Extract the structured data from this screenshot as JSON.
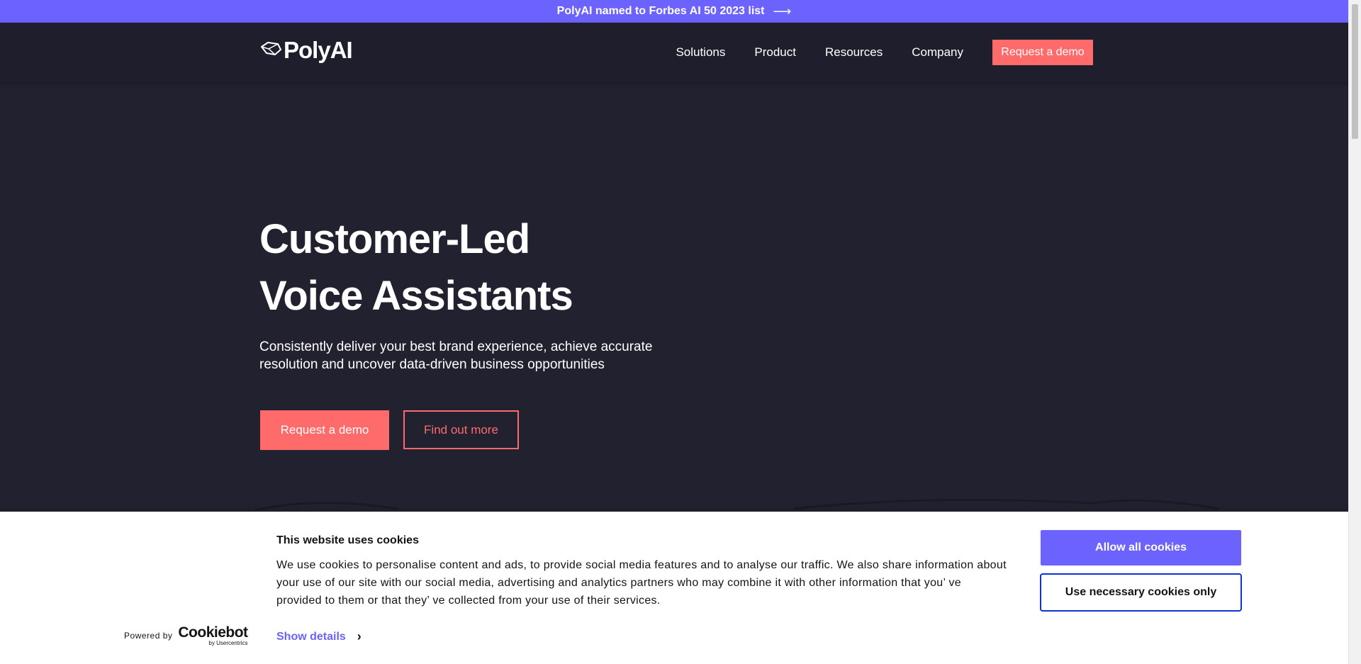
{
  "announcement": {
    "text": "PolyAI named to Forbes AI 50 2023 list",
    "arrow": "⟶"
  },
  "header": {
    "logo_text": "PolyAI",
    "nav": [
      "Solutions",
      "Product",
      "Resources",
      "Company"
    ],
    "cta": "Request a demo"
  },
  "hero": {
    "title_line1": "Customer-Led",
    "title_line2": "Voice Assistants",
    "subtitle": "Consistently deliver your best brand experience, achieve accurate resolution and uncover data-driven business opportunities",
    "primary_cta": "Request a demo",
    "secondary_cta": "Find out more"
  },
  "cookie_banner": {
    "title": "This website uses cookies",
    "text": "We use cookies to personalise content and ads, to provide social media features and to analyse our traffic. We also share information about your use of our site with our social media, advertising and analytics partners who may combine it with other information that you’ ve provided to them or that they’ ve collected from your use of their services.",
    "powered_by": "Powered by",
    "brand": "Cookiebot",
    "brand_sub": "by Usercentrics",
    "show_details": "Show details",
    "allow_all": "Allow all cookies",
    "necessary_only": "Use necessary cookies only"
  },
  "colors": {
    "announcement_bg": "#6c63ff",
    "page_bg": "#22212f",
    "header_bg": "#1e1e2c",
    "accent_coral": "#ff6b6b",
    "cookie_purple": "#6c63ff",
    "focus_blue": "#1032cf"
  }
}
